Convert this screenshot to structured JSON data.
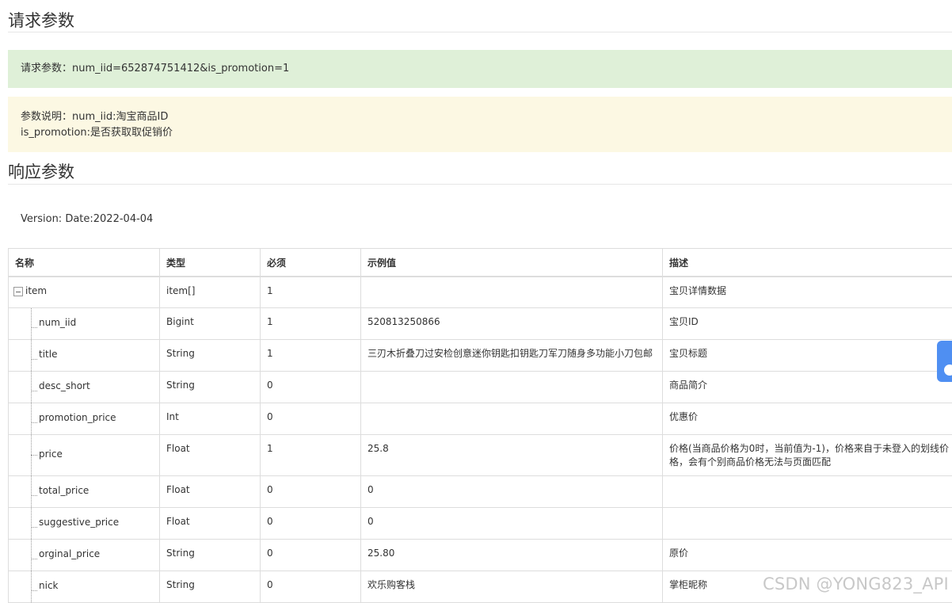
{
  "request_section": {
    "title": "请求参数",
    "params_text": "请求参数：num_iid=652874751412&is_promotion=1",
    "desc_line1": "参数说明：num_iid:淘宝商品ID",
    "desc_line2": "is_promotion:是否获取取促销价"
  },
  "response_section": {
    "title": "响应参数",
    "version": "Version: Date:2022-04-04",
    "headers": [
      "名称",
      "类型",
      "必须",
      "示例值",
      "描述"
    ],
    "root": {
      "name": "item",
      "type": "item[]",
      "required": "1",
      "example": "",
      "desc": "宝贝详情数据"
    },
    "rows": [
      {
        "name": "num_iid",
        "type": "Bigint",
        "required": "1",
        "example": "520813250866",
        "desc": "宝贝ID"
      },
      {
        "name": "title",
        "type": "String",
        "required": "1",
        "example": "三刃木折叠刀过安检创意迷你钥匙扣钥匙刀军刀随身多功能小刀包邮",
        "desc": "宝贝标题"
      },
      {
        "name": "desc_short",
        "type": "String",
        "required": "0",
        "example": "",
        "desc": "商品简介"
      },
      {
        "name": "promotion_price",
        "type": "Int",
        "required": "0",
        "example": "",
        "desc": "优惠价"
      },
      {
        "name": "price",
        "type": "Float",
        "required": "1",
        "example": "25.8",
        "desc": "价格(当商品价格为0时，当前值为-1)，价格来自于未登入的划线价格，会有个别商品价格无法与页面匹配"
      },
      {
        "name": "total_price",
        "type": "Float",
        "required": "0",
        "example": "0",
        "desc": ""
      },
      {
        "name": "suggestive_price",
        "type": "Float",
        "required": "0",
        "example": "0",
        "desc": ""
      },
      {
        "name": "orginal_price",
        "type": "String",
        "required": "0",
        "example": "25.80",
        "desc": "原价"
      },
      {
        "name": "nick",
        "type": "String",
        "required": "0",
        "example": "欢乐购客栈",
        "desc": "掌柜昵称"
      }
    ]
  },
  "watermark": "CSDN @YONG823_API",
  "icons": {
    "collapse": "minus-square-icon",
    "side_widget": "side-assistant-icon"
  }
}
